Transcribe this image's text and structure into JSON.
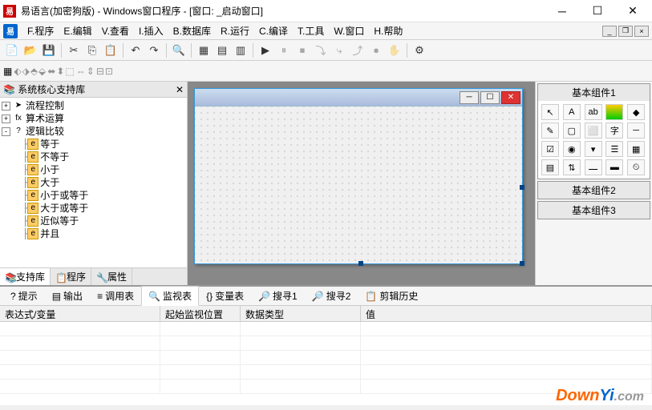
{
  "title": "易语言(加密狗版) - Windows窗口程序 - [窗口: _启动窗口]",
  "menu": [
    "F.程序",
    "E.编辑",
    "V.查看",
    "I.插入",
    "B.数据库",
    "R.运行",
    "C.编译",
    "T.工具",
    "W.窗口",
    "H.帮助"
  ],
  "tree": {
    "root": "系统核心支持库",
    "items": [
      {
        "label": "流程控制",
        "exp": "+",
        "ico": "arrow"
      },
      {
        "label": "算术运算",
        "exp": "+",
        "ico": "fx"
      },
      {
        "label": "逻辑比较",
        "exp": "-",
        "ico": "q"
      },
      {
        "label": "等于",
        "child": true
      },
      {
        "label": "不等于",
        "child": true
      },
      {
        "label": "小于",
        "child": true
      },
      {
        "label": "大于",
        "child": true
      },
      {
        "label": "小于或等于",
        "child": true
      },
      {
        "label": "大于或等于",
        "child": true
      },
      {
        "label": "近似等于",
        "child": true
      },
      {
        "label": "并且",
        "child": true
      }
    ]
  },
  "left_tabs": [
    "支持库",
    "程序",
    "属性"
  ],
  "right": {
    "groups": [
      "基本组件1",
      "基本组件2",
      "基本组件3"
    ]
  },
  "bottom_tabs": [
    "提示",
    "输出",
    "调用表",
    "监视表",
    "变量表",
    "搜寻1",
    "搜寻2",
    "剪辑历史"
  ],
  "watch_cols": [
    "表达式/变量",
    "起始监视位置",
    "数据类型",
    "值"
  ],
  "watermark": {
    "a": "Down",
    "b": "Yi",
    "c": ".com"
  }
}
